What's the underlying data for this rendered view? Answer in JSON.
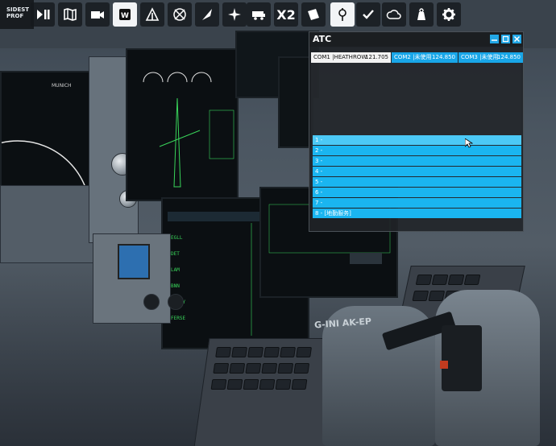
{
  "toolbar": {
    "left_label_line1": "SIDEST",
    "left_label_line2": "PROF",
    "icons": [
      "play-pause-icon",
      "map-icon",
      "camera-icon",
      "logbook-icon",
      "flight-info-icon",
      "weather-icon",
      "checklist-icon",
      "navlog-icon",
      "vfr-map-icon",
      "multiplayer-icon",
      "sim-rate-icon",
      "notepad-icon",
      "atc-icon",
      "objectives-icon",
      "cloud-icon",
      "weight-icon",
      "settings-icon"
    ],
    "sim_rate_label": "X2"
  },
  "atc": {
    "title": "ATC",
    "tabs": [
      {
        "name": "COM1 |HEATHROW",
        "freq": "121.705",
        "active": true
      },
      {
        "name": "COM2 |未使用",
        "freq": "124.850",
        "active": false
      },
      {
        "name": "COM3 |未使用",
        "freq": "124.850",
        "active": false
      }
    ],
    "options": [
      "1 -",
      "2 -",
      "3 -",
      "4 -",
      "5 -",
      "6 -",
      "7 -",
      "8 - [地勤服务]"
    ],
    "colors": {
      "accent": "#1ab5f0",
      "title_bar": "#1b1e21"
    }
  },
  "cockpit": {
    "registration": "G-INI AK-EP"
  }
}
